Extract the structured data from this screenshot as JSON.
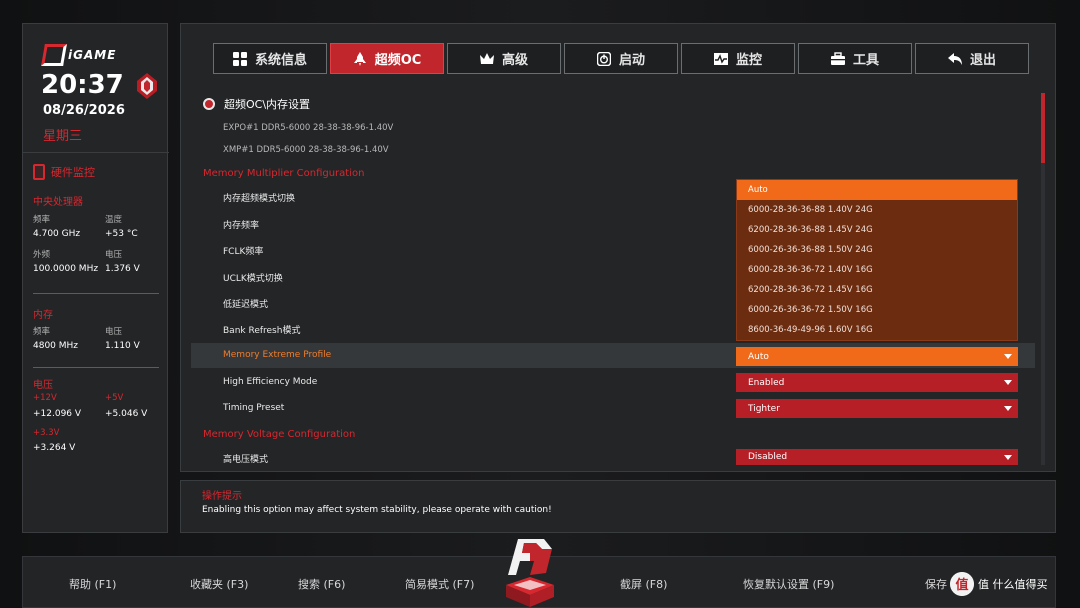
{
  "sidebar": {
    "brand": "iGAME",
    "time": "20:37",
    "date": "08/26/2026",
    "weekday": "星期三",
    "hw_monitor_title": "硬件监控",
    "cpu": {
      "title": "中央处理器",
      "freq_label": "频率",
      "freq_value": "4.700 GHz",
      "temp_label": "温度",
      "temp_value": "+53 °C",
      "bclk_label": "外频",
      "bclk_value": "100.0000 MHz",
      "volt_label": "电压",
      "volt_value": "1.376 V"
    },
    "memory": {
      "title": "内存",
      "freq_label": "频率",
      "freq_value": "4800 MHz",
      "volt_label": "电压",
      "volt_value": "1.110 V"
    },
    "voltage": {
      "title": "电压",
      "v12_label": "+12V",
      "v12_value": "+12.096 V",
      "v5_label": "+5V",
      "v5_value": "+5.046 V",
      "v33_label": "+3.3V",
      "v33_value": "+3.264 V"
    }
  },
  "nav": {
    "tabs": [
      {
        "label": "系统信息",
        "icon": "grid-icon"
      },
      {
        "label": "超频OC",
        "icon": "rocket-icon",
        "active": true
      },
      {
        "label": "高级",
        "icon": "crown-icon"
      },
      {
        "label": "启动",
        "icon": "power-icon"
      },
      {
        "label": "监控",
        "icon": "pulse-icon"
      },
      {
        "label": "工具",
        "icon": "toolbox-icon"
      },
      {
        "label": "退出",
        "icon": "back-arrow-icon"
      }
    ]
  },
  "main": {
    "breadcrumb": "超频OC\\内存设置",
    "expo_info": "EXPO#1 DDR5-6000 28-38-38-96-1.40V",
    "xmp_info": "XMP#1   DDR5-6000 28-38-38-96-1.40V",
    "mult_heading": "Memory Multiplier Configuration",
    "rows": {
      "oc_mode": "内存超频模式切换",
      "mem_freq": "内存频率",
      "fclk": "FCLK频率",
      "uclk": "UCLK模式切换",
      "low_latency": "低延迟模式",
      "bank_refresh": "Bank Refresh模式",
      "mem_extreme": "Memory Extreme Profile",
      "high_eff": "High Efficiency Mode",
      "timing_preset": "Timing Preset"
    },
    "voltage_heading": "Memory Voltage Configuration",
    "high_volt_label": "高电压模式",
    "values": {
      "mem_extreme": "Auto",
      "high_eff": "Enabled",
      "timing_preset": "Tighter",
      "high_volt": "Disabled"
    },
    "dropdown_options": [
      "Auto",
      "6000-28-36-36-88 1.40V 24G",
      "6200-28-36-36-88 1.45V 24G",
      "6000-26-36-36-88 1.50V 24G",
      "6000-28-36-36-72 1.40V 16G",
      "6200-28-36-36-72 1.45V 16G",
      "6000-26-36-36-72 1.50V 16G",
      "8600-36-49-49-96 1.60V 16G"
    ]
  },
  "hint": {
    "title": "操作提示",
    "text": "Enabling this option may affect system stability, please operate with caution!"
  },
  "footer": {
    "keys": [
      "帮助 (F1)",
      "收藏夹 (F3)",
      "搜索 (F6)",
      "简易模式 (F7)",
      "截屏 (F8)",
      "恢复默认设置 (F9)",
      "保存"
    ],
    "watermark": "值 什么值得买"
  },
  "colors": {
    "accent_red": "#c1262c",
    "accent_orange": "#f06a1a",
    "text_red": "#d7282f"
  }
}
